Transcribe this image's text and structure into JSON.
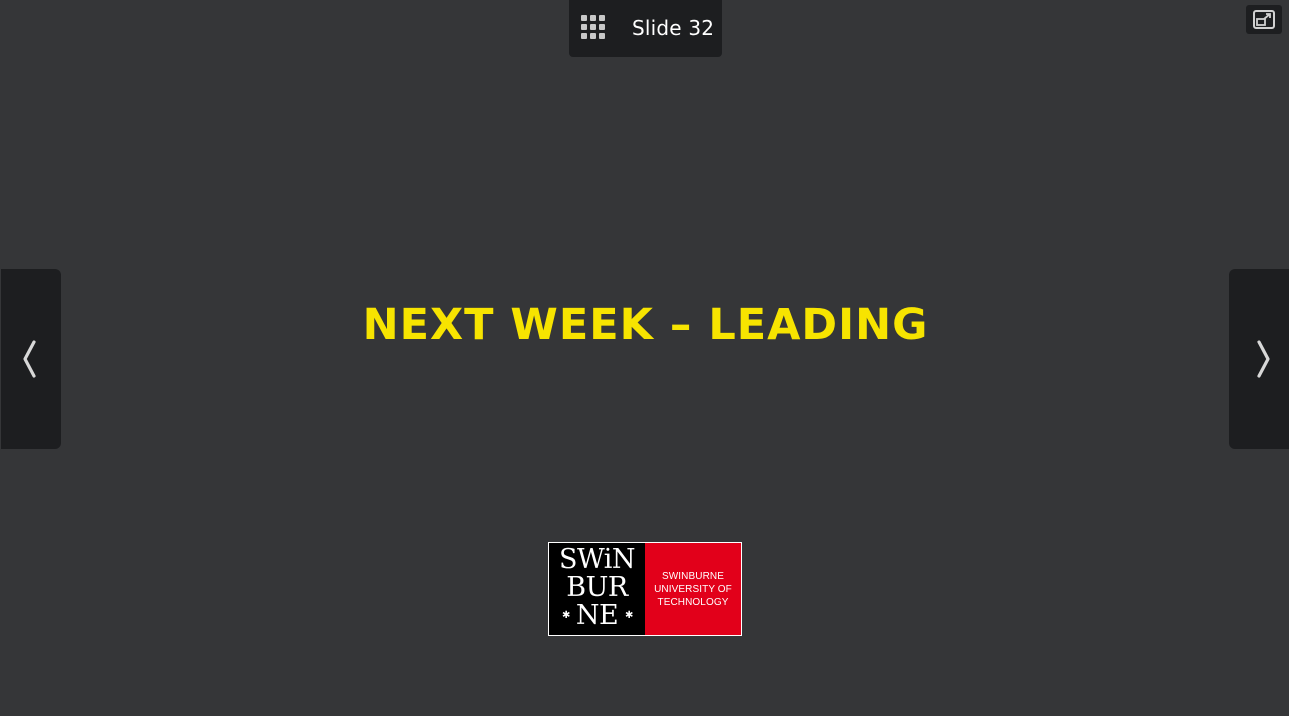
{
  "toolbar": {
    "slide_label": "Slide 32",
    "grid_icon": "grid-icon",
    "popout_icon": "popout-icon"
  },
  "navigation": {
    "prev_icon": "chevron-left-icon",
    "next_icon": "chevron-right-icon"
  },
  "slide": {
    "title": "NEXT WEEK – LEADING",
    "title_color": "#f7e400",
    "background_color": "#353638"
  },
  "logo": {
    "line1": "SWiN",
    "line2": "BUR",
    "line3": "NE",
    "star": "✱",
    "text_line1": "SWINBURNE",
    "text_line2": "UNIVERSITY OF",
    "text_line3": "TECHNOLOGY",
    "red_color": "#e2001a"
  }
}
